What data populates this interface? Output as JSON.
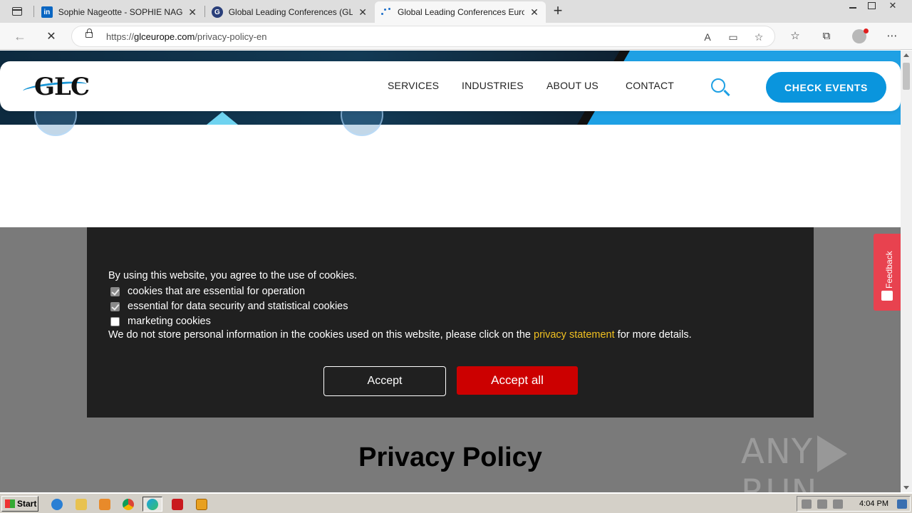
{
  "browser": {
    "tabs": [
      {
        "title": "Sophie Nageotte - SOPHIE NAGEOTTE",
        "favicon": "linkedin-icon",
        "active": false
      },
      {
        "title": "Global Leading Conferences (GLC)",
        "favicon": "glc-globe-icon",
        "active": false
      },
      {
        "title": "Global Leading Conferences Europe",
        "favicon": "loading-spinner-icon",
        "active": true
      }
    ],
    "address": {
      "prefix": "https://",
      "domain": "glceurope.com",
      "path": "/privacy-policy-en"
    }
  },
  "site": {
    "logo_text": "GLC",
    "nav": [
      "SERVICES",
      "INDUSTRIES",
      "ABOUT US",
      "CONTACT"
    ],
    "cta_label": "CHECK EVENTS",
    "colors": {
      "brand_blue": "#0a95dd",
      "accept_all_red": "#cc0000",
      "link_yellow": "#f0c020"
    }
  },
  "cookie_banner": {
    "intro": "By using this website, you agree to the use of cookies.",
    "options": [
      {
        "label": "cookies that are essential for operation",
        "checked": true
      },
      {
        "label": "essential for data security and statistical cookies",
        "checked": true
      },
      {
        "label": "marketing cookies",
        "checked": false
      }
    ],
    "note_before": "We do not store personal information in the cookies used on this website, please click on the ",
    "note_link": "privacy statement",
    "note_after": " for more details.",
    "accept_label": "Accept",
    "accept_all_label": "Accept all"
  },
  "page": {
    "title": "Privacy Policy"
  },
  "feedback_label": "Feedback",
  "watermark": {
    "left": "ANY",
    "right": "RUN"
  },
  "taskbar": {
    "start_label": "Start",
    "clock": "4:04 PM"
  }
}
